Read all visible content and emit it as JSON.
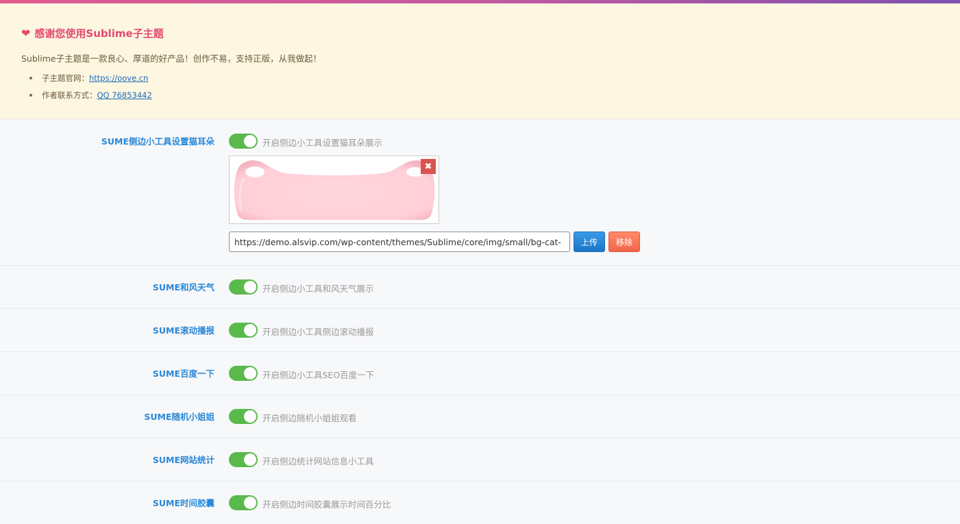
{
  "notice": {
    "title": "感谢您使用Sublime子主题",
    "description": "Sublime子主题是一款良心、厚道的好产品！创作不易，支持正版，从我做起！",
    "items": [
      {
        "label": "子主题官网：",
        "link": "https://oove.cn"
      },
      {
        "label": "作者联系方式：",
        "link": "QQ 76853442"
      }
    ]
  },
  "settings": [
    {
      "label": "SUME侧边小工具设置猫耳朵",
      "switch_on": true,
      "description": "开启侧边小工具设置猫耳朵展示",
      "image_url": "https://demo.alsvip.com/wp-content/themes/Sublime/core/img/small/bg-cat-",
      "upload_label": "上传",
      "remove_label": "移除"
    },
    {
      "label": "SUME和风天气",
      "switch_on": true,
      "description": "开启侧边小工具和风天气展示"
    },
    {
      "label": "SUME滚动播报",
      "switch_on": true,
      "description": "开启侧边小工具侧边滚动播报"
    },
    {
      "label": "SUME百度一下",
      "switch_on": true,
      "description": "开启侧边小工具SEO百度一下"
    },
    {
      "label": "SUME随机小姐姐",
      "switch_on": true,
      "description": "开启侧边随机小姐姐观看"
    },
    {
      "label": "SUME网站统计",
      "switch_on": true,
      "description": "开启侧边统计网站信息小工具"
    },
    {
      "label": "SUME时间胶囊",
      "switch_on": true,
      "description": "开启侧边时间胶囊展示时间百分比"
    }
  ],
  "colors": {
    "accent": "#2a88d6",
    "switch_on": "#5ab94b",
    "notice_bg": "#fdf6e1",
    "title_pink": "#e34a6f"
  }
}
